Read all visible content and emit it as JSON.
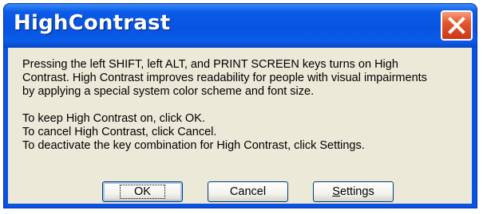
{
  "window": {
    "title": "HighContrast",
    "close_icon": "close-x-icon"
  },
  "message": {
    "lines": [
      "Pressing the left SHIFT, left ALT, and PRINT SCREEN keys turns on High",
      "Contrast. High Contrast improves readability for people with visual impairments",
      "by applying a special system color scheme and font size.",
      "To keep High Contrast on, click OK.",
      "To cancel High Contrast, click Cancel.",
      "To deactivate the key combination for High Contrast, click Settings."
    ]
  },
  "buttons": {
    "ok": "OK",
    "cancel": "Cancel",
    "settings_accel": "S",
    "settings_rest": "ettings"
  },
  "colors": {
    "titlebar": "#0653e0",
    "client": "#ece9d8",
    "close_button": "#e2572c"
  }
}
